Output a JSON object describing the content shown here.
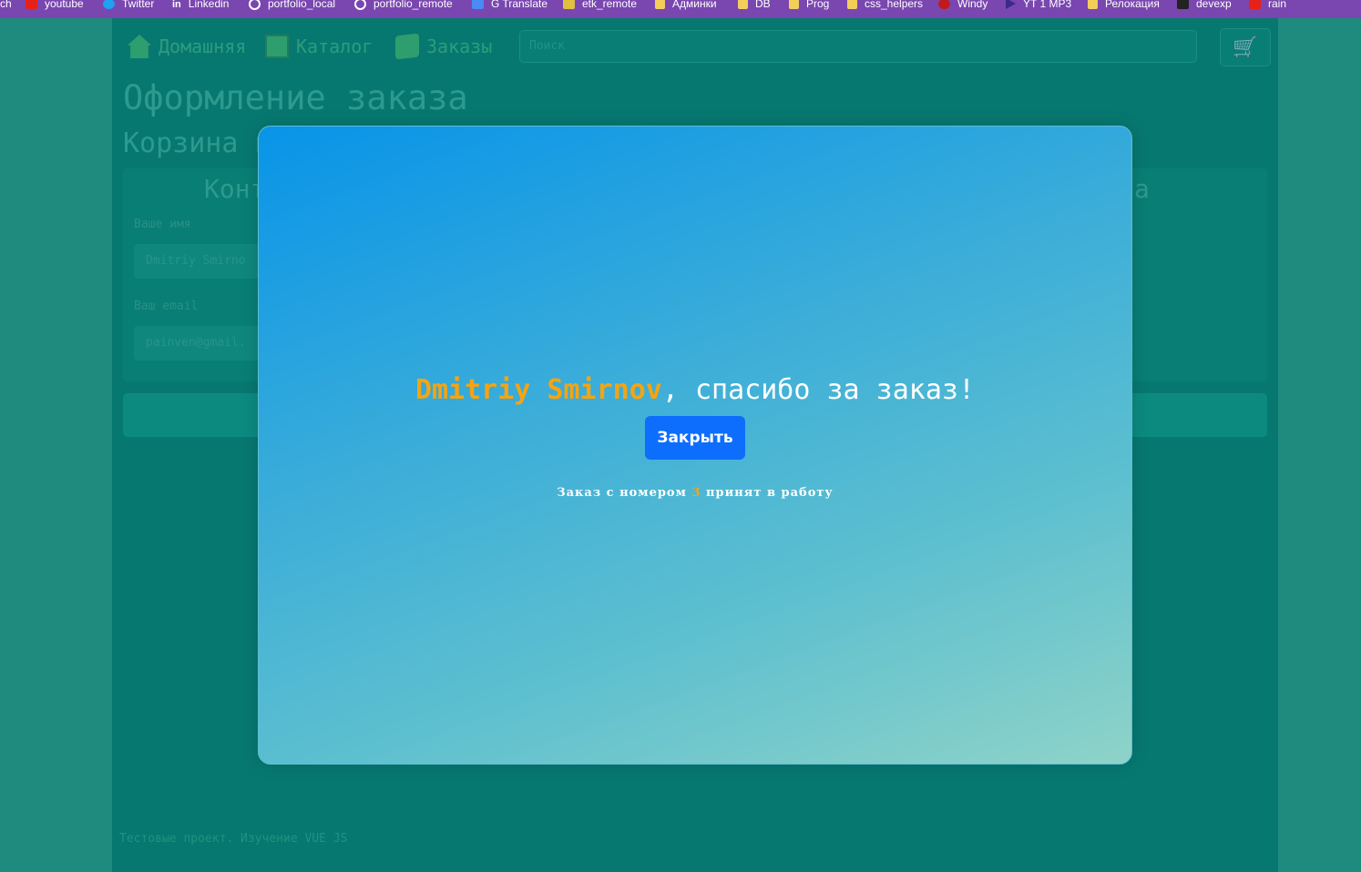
{
  "bookmarks": [
    {
      "label": "ch",
      "icon": "none"
    },
    {
      "label": "youtube",
      "icon": "youtube-icon"
    },
    {
      "label": "Twitter",
      "icon": "twitter-icon"
    },
    {
      "label": "Linkedin",
      "icon": "linkedin-icon"
    },
    {
      "label": "portfolio_local",
      "icon": "globe-icon"
    },
    {
      "label": "portfolio_remote",
      "icon": "globe-icon"
    },
    {
      "label": "G Translate",
      "icon": "translate-icon"
    },
    {
      "label": "etk_remote",
      "icon": "etk-icon"
    },
    {
      "label": "Админки",
      "icon": "folder-icon"
    },
    {
      "label": "DB",
      "icon": "folder-icon"
    },
    {
      "label": "Prog",
      "icon": "folder-icon"
    },
    {
      "label": "css_helpers",
      "icon": "folder-icon"
    },
    {
      "label": "Windy",
      "icon": "windy-icon"
    },
    {
      "label": "YT 1 MP3",
      "icon": "play-icon"
    },
    {
      "label": "Релокация",
      "icon": "folder-icon"
    },
    {
      "label": "devexp",
      "icon": "devexp-icon"
    },
    {
      "label": "rain",
      "icon": "youtube-icon"
    }
  ],
  "nav": {
    "home": "Домашняя",
    "catalog": "Каталог",
    "orders": "Заказы",
    "search_placeholder": "Поиск"
  },
  "page": {
    "title": "Оформление заказа",
    "subtitle": "Корзина п",
    "contacts_title": "Конт",
    "right_title": "а",
    "name_label": "Ваше имя",
    "name_value": "Dmitriy Smirno",
    "email_label": "Ваш email",
    "email_value": "painven@gmail."
  },
  "footer": {
    "text": "Тестовые проект. Изучение VUE JS"
  },
  "modal": {
    "customer_name": "Dmitriy Smirnov",
    "thanks_text": ", спасибо за заказ!",
    "close_label": "Закрыть",
    "order_prefix": "Заказ с номером",
    "order_number": "3",
    "order_suffix": "принят в работу"
  },
  "colors": {
    "accent": "#f5a412",
    "button": "#0d6efd",
    "bookmarks_bar": "#7a46b0"
  }
}
